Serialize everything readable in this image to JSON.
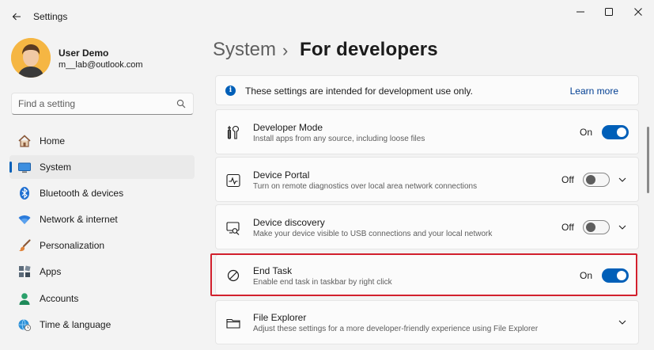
{
  "window": {
    "title": "Settings",
    "back_icon": "arrow-left-icon",
    "controls": [
      "minimize-icon",
      "maximize-icon",
      "close-icon"
    ]
  },
  "profile": {
    "name": "User Demo",
    "email": "m__lab@outlook.com"
  },
  "search": {
    "placeholder": "Find a setting",
    "value": ""
  },
  "nav": {
    "items": [
      {
        "label": "Home",
        "icon": "home-icon",
        "selected": false
      },
      {
        "label": "System",
        "icon": "system-display-icon",
        "selected": true
      },
      {
        "label": "Bluetooth & devices",
        "icon": "bluetooth-icon",
        "selected": false
      },
      {
        "label": "Network & internet",
        "icon": "wifi-icon",
        "selected": false
      },
      {
        "label": "Personalization",
        "icon": "brush-icon",
        "selected": false
      },
      {
        "label": "Apps",
        "icon": "apps-icon",
        "selected": false
      },
      {
        "label": "Accounts",
        "icon": "person-icon",
        "selected": false
      },
      {
        "label": "Time & language",
        "icon": "globe-clock-icon",
        "selected": false
      }
    ]
  },
  "header": {
    "parent": "System",
    "separator": "›",
    "current": "For developers"
  },
  "info_banner": {
    "text": "These settings are intended for development use only.",
    "link": "Learn more",
    "icon": "info-icon"
  },
  "settings": [
    {
      "title": "Developer Mode",
      "description": "Install apps from any source, including loose files",
      "state": "On",
      "toggle": true,
      "expandable": false,
      "icon": "developer-tools-icon"
    },
    {
      "title": "Device Portal",
      "description": "Turn on remote diagnostics over local area network connections",
      "state": "Off",
      "toggle": false,
      "expandable": true,
      "icon": "device-portal-icon"
    },
    {
      "title": "Device discovery",
      "description": "Make your device visible to USB connections and your local network",
      "state": "Off",
      "toggle": false,
      "expandable": true,
      "icon": "device-discovery-icon"
    },
    {
      "title": "End Task",
      "description": "Enable end task in taskbar by right click",
      "state": "On",
      "toggle": true,
      "expandable": false,
      "icon": "block-icon",
      "highlighted": true
    },
    {
      "title": "File Explorer",
      "description": "Adjust these settings for a more developer-friendly experience using File Explorer",
      "state": "",
      "toggle": null,
      "expandable": true,
      "icon": "folder-icon"
    }
  ],
  "colors": {
    "accent": "#005fb8",
    "highlight": "#d2202d",
    "background": "#f3f3f3",
    "card": "#fbfbfb"
  }
}
